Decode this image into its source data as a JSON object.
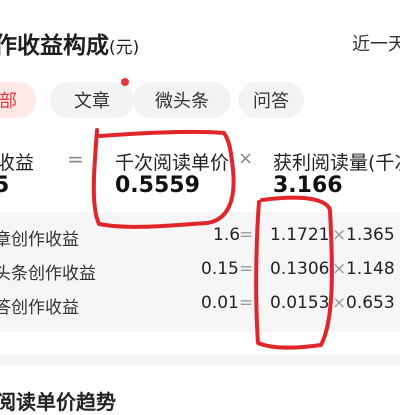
{
  "header": {
    "title": "作收益构成",
    "unit": "(元)",
    "range": "近一天"
  },
  "tabs": [
    {
      "label": "部",
      "active": true
    },
    {
      "label": "文章",
      "active": false,
      "badge": true
    },
    {
      "label": "微头条",
      "active": false
    },
    {
      "label": "问答",
      "active": false
    }
  ],
  "formula": {
    "left_label": "收益",
    "left_value": "5",
    "eq": "=",
    "mid_label": "千次阅读单价",
    "mid_value": "0.5559",
    "times": "×",
    "right_label": "获利阅读量(千次",
    "right_value": "3.166"
  },
  "rows": [
    {
      "label": "章创作收益",
      "total": "1.6",
      "eq": "=",
      "price": "1.1721",
      "times": "×",
      "views": "1.365"
    },
    {
      "label": "头条创作收益",
      "total": "0.15",
      "eq": "=",
      "price": "0.1306",
      "times": "×",
      "views": "1.148"
    },
    {
      "label": "答创作收益",
      "total": "0.01",
      "eq": "=",
      "price": "0.0153",
      "times": "×",
      "views": "0.653"
    }
  ],
  "section2": {
    "title": "阅读单价趋势"
  },
  "colors": {
    "accent": "#e4393c",
    "annotation": "#e0262b",
    "tab_active_bg": "#ffe9e6"
  }
}
